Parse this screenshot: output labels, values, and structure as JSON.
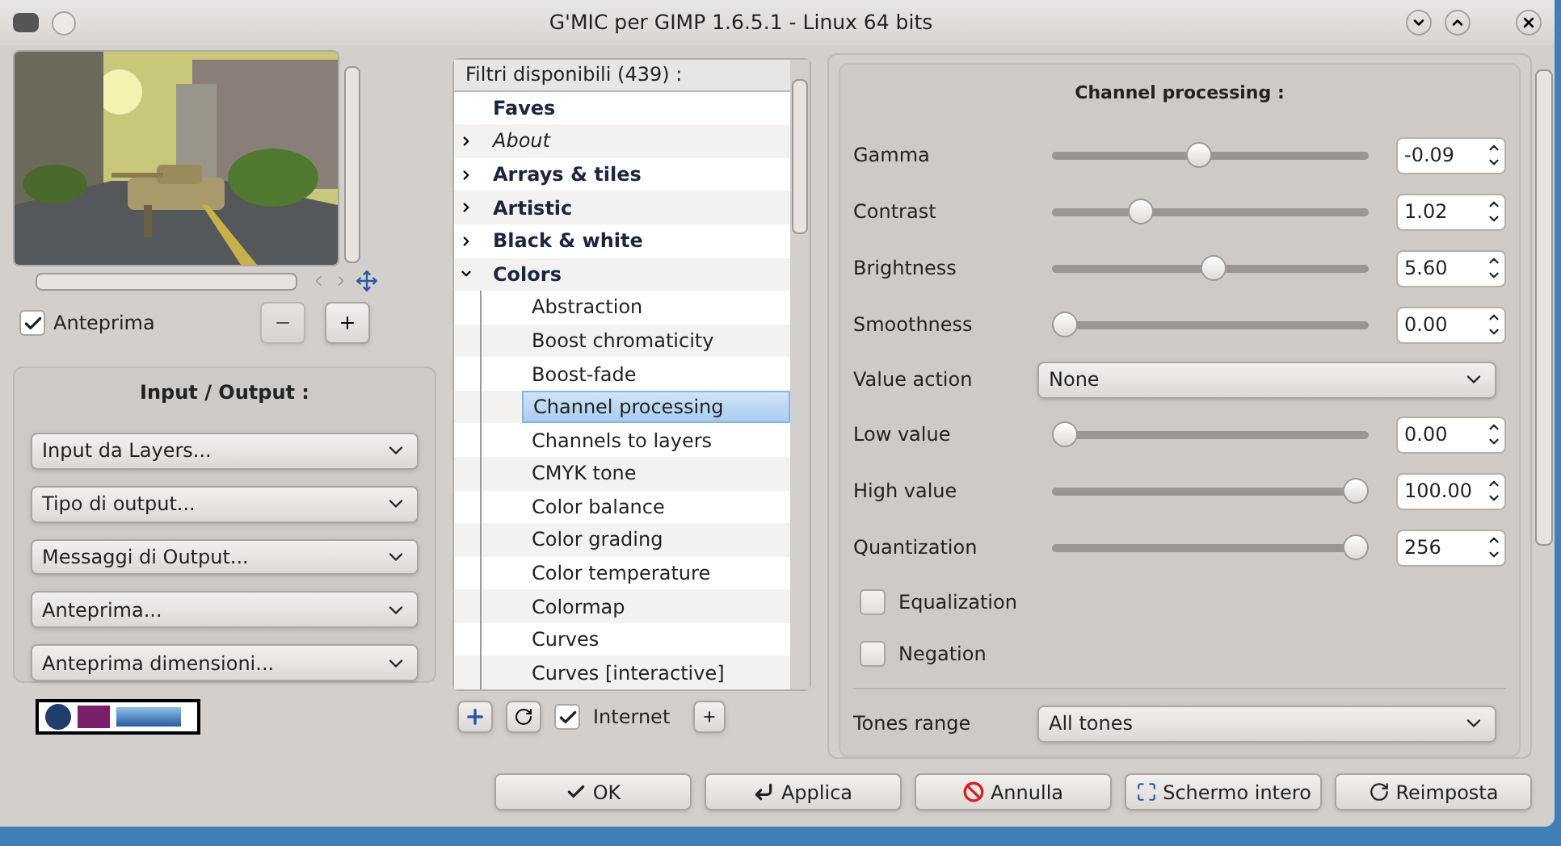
{
  "window": {
    "title": "G'MIC per GIMP 1.6.5.1 - Linux 64 bits"
  },
  "preview": {
    "checkbox": {
      "label": "Anteprima",
      "checked": true
    }
  },
  "io_panel": {
    "title": "Input / Output :",
    "dropdowns": [
      "Input da Layers...",
      "Tipo di output...",
      "Messaggi di Output...",
      "Anteprima...",
      "Anteprima dimensioni..."
    ]
  },
  "filters": {
    "header": "Filtri disponibili (439) :",
    "tree": [
      {
        "label": "Faves",
        "kind": "category",
        "selected": false
      },
      {
        "label": "About",
        "kind": "note",
        "expanded": false,
        "selected": false
      },
      {
        "label": "Arrays & tiles",
        "kind": "category",
        "expanded": false,
        "selected": false
      },
      {
        "label": "Artistic",
        "kind": "category",
        "expanded": false,
        "selected": false
      },
      {
        "label": "Black & white",
        "kind": "category",
        "expanded": false,
        "selected": false
      },
      {
        "label": "Colors",
        "kind": "category",
        "expanded": true,
        "selected": false,
        "children": [
          {
            "label": "Abstraction",
            "selected": false
          },
          {
            "label": "Boost chromaticity",
            "selected": false
          },
          {
            "label": "Boost-fade",
            "selected": false
          },
          {
            "label": "Channel processing",
            "selected": true
          },
          {
            "label": "Channels to layers",
            "selected": false
          },
          {
            "label": "CMYK tone",
            "selected": false
          },
          {
            "label": "Color balance",
            "selected": false
          },
          {
            "label": "Color grading",
            "selected": false
          },
          {
            "label": "Color temperature",
            "selected": false
          },
          {
            "label": "Colormap",
            "selected": false
          },
          {
            "label": "Curves",
            "selected": false
          },
          {
            "label": "Curves [interactive]",
            "selected": false
          }
        ]
      }
    ],
    "internet": {
      "label": "Internet",
      "checked": true
    }
  },
  "settings": {
    "title": "Channel processing :",
    "params": [
      {
        "kind": "slider",
        "label": "Gamma",
        "level": 0.46,
        "value": "-0.09"
      },
      {
        "kind": "slider",
        "label": "Contrast",
        "level": 0.26,
        "value": "1.02"
      },
      {
        "kind": "slider",
        "label": "Brightness",
        "level": 0.51,
        "value": "5.60"
      },
      {
        "kind": "slider",
        "label": "Smoothness",
        "level": 0,
        "value": "0.00"
      },
      {
        "kind": "select",
        "label": "Value action",
        "value": "None"
      },
      {
        "kind": "slider",
        "label": "Low value",
        "level": 0,
        "value": "0.00"
      },
      {
        "kind": "slider",
        "label": "High value",
        "level": 1,
        "value": "100.00"
      },
      {
        "kind": "slider",
        "label": "Quantization",
        "level": 1,
        "value": "256"
      },
      {
        "kind": "checkbox",
        "label": "Equalization",
        "checked": false
      },
      {
        "kind": "checkbox",
        "label": "Negation",
        "checked": false
      },
      {
        "kind": "separator"
      },
      {
        "kind": "select",
        "label": "Tones range",
        "value": "All tones"
      }
    ]
  },
  "buttons": [
    {
      "label": "OK",
      "kind": "ok"
    },
    {
      "label": "Applica",
      "kind": "apply"
    },
    {
      "label": "Annulla",
      "kind": "cancel"
    },
    {
      "label": "Schermo intero",
      "kind": "fullscreen"
    },
    {
      "label": "Reimposta",
      "kind": "reset"
    }
  ]
}
